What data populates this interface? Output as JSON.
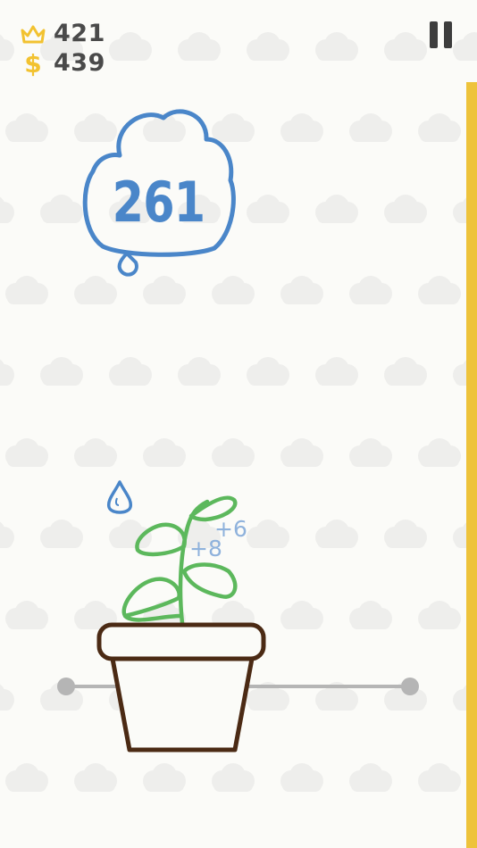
{
  "hud": {
    "score": "421",
    "coins": "439",
    "score_icon": "crown-icon",
    "coins_icon": "dollar-icon",
    "pause_icon": "pause-icon"
  },
  "cloud": {
    "count": "261",
    "icon": "raincloud-icon"
  },
  "floating_points": [
    "+6",
    "+8"
  ],
  "progress": 1.0,
  "colors": {
    "background": "#fbfbf8",
    "pattern": "#eeeeec",
    "hud_text": "#4a4a4a",
    "crown": "#f2c230",
    "cloud": "#4a86c9",
    "raindrop": "#4a86c9",
    "points": "#8fb2dc",
    "plant": "#5cb85c",
    "pot": "#4b2a14",
    "track": "#b5b5b5",
    "progress_bar": "#eec33b"
  }
}
